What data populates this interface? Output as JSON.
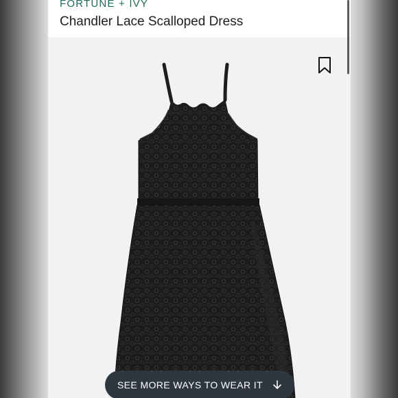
{
  "product": {
    "brand": "FORTUNE + IVY",
    "title": "Chandler Lace Scalloped Dress"
  },
  "actions": {
    "see_more_label": "SEE MORE WAYS TO WEAR IT"
  },
  "icons": {
    "bookmark": "bookmark-icon",
    "arrow": "arrow-down-icon"
  },
  "colors": {
    "brand": "#1e6a5a",
    "cta_background": "#2e3640",
    "dress": "#1b1b1c"
  }
}
